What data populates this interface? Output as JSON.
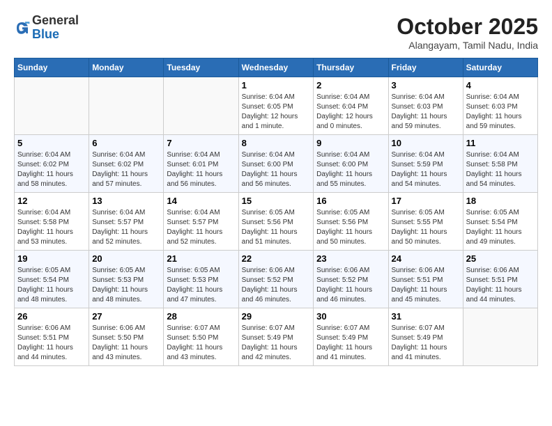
{
  "header": {
    "logo_line1": "General",
    "logo_line2": "Blue",
    "month": "October 2025",
    "location": "Alangayam, Tamil Nadu, India"
  },
  "weekdays": [
    "Sunday",
    "Monday",
    "Tuesday",
    "Wednesday",
    "Thursday",
    "Friday",
    "Saturday"
  ],
  "weeks": [
    [
      {
        "day": "",
        "info": ""
      },
      {
        "day": "",
        "info": ""
      },
      {
        "day": "",
        "info": ""
      },
      {
        "day": "1",
        "info": "Sunrise: 6:04 AM\nSunset: 6:05 PM\nDaylight: 12 hours\nand 1 minute."
      },
      {
        "day": "2",
        "info": "Sunrise: 6:04 AM\nSunset: 6:04 PM\nDaylight: 12 hours\nand 0 minutes."
      },
      {
        "day": "3",
        "info": "Sunrise: 6:04 AM\nSunset: 6:03 PM\nDaylight: 11 hours\nand 59 minutes."
      },
      {
        "day": "4",
        "info": "Sunrise: 6:04 AM\nSunset: 6:03 PM\nDaylight: 11 hours\nand 59 minutes."
      }
    ],
    [
      {
        "day": "5",
        "info": "Sunrise: 6:04 AM\nSunset: 6:02 PM\nDaylight: 11 hours\nand 58 minutes."
      },
      {
        "day": "6",
        "info": "Sunrise: 6:04 AM\nSunset: 6:02 PM\nDaylight: 11 hours\nand 57 minutes."
      },
      {
        "day": "7",
        "info": "Sunrise: 6:04 AM\nSunset: 6:01 PM\nDaylight: 11 hours\nand 56 minutes."
      },
      {
        "day": "8",
        "info": "Sunrise: 6:04 AM\nSunset: 6:00 PM\nDaylight: 11 hours\nand 56 minutes."
      },
      {
        "day": "9",
        "info": "Sunrise: 6:04 AM\nSunset: 6:00 PM\nDaylight: 11 hours\nand 55 minutes."
      },
      {
        "day": "10",
        "info": "Sunrise: 6:04 AM\nSunset: 5:59 PM\nDaylight: 11 hours\nand 54 minutes."
      },
      {
        "day": "11",
        "info": "Sunrise: 6:04 AM\nSunset: 5:58 PM\nDaylight: 11 hours\nand 54 minutes."
      }
    ],
    [
      {
        "day": "12",
        "info": "Sunrise: 6:04 AM\nSunset: 5:58 PM\nDaylight: 11 hours\nand 53 minutes."
      },
      {
        "day": "13",
        "info": "Sunrise: 6:04 AM\nSunset: 5:57 PM\nDaylight: 11 hours\nand 52 minutes."
      },
      {
        "day": "14",
        "info": "Sunrise: 6:04 AM\nSunset: 5:57 PM\nDaylight: 11 hours\nand 52 minutes."
      },
      {
        "day": "15",
        "info": "Sunrise: 6:05 AM\nSunset: 5:56 PM\nDaylight: 11 hours\nand 51 minutes."
      },
      {
        "day": "16",
        "info": "Sunrise: 6:05 AM\nSunset: 5:56 PM\nDaylight: 11 hours\nand 50 minutes."
      },
      {
        "day": "17",
        "info": "Sunrise: 6:05 AM\nSunset: 5:55 PM\nDaylight: 11 hours\nand 50 minutes."
      },
      {
        "day": "18",
        "info": "Sunrise: 6:05 AM\nSunset: 5:54 PM\nDaylight: 11 hours\nand 49 minutes."
      }
    ],
    [
      {
        "day": "19",
        "info": "Sunrise: 6:05 AM\nSunset: 5:54 PM\nDaylight: 11 hours\nand 48 minutes."
      },
      {
        "day": "20",
        "info": "Sunrise: 6:05 AM\nSunset: 5:53 PM\nDaylight: 11 hours\nand 48 minutes."
      },
      {
        "day": "21",
        "info": "Sunrise: 6:05 AM\nSunset: 5:53 PM\nDaylight: 11 hours\nand 47 minutes."
      },
      {
        "day": "22",
        "info": "Sunrise: 6:06 AM\nSunset: 5:52 PM\nDaylight: 11 hours\nand 46 minutes."
      },
      {
        "day": "23",
        "info": "Sunrise: 6:06 AM\nSunset: 5:52 PM\nDaylight: 11 hours\nand 46 minutes."
      },
      {
        "day": "24",
        "info": "Sunrise: 6:06 AM\nSunset: 5:51 PM\nDaylight: 11 hours\nand 45 minutes."
      },
      {
        "day": "25",
        "info": "Sunrise: 6:06 AM\nSunset: 5:51 PM\nDaylight: 11 hours\nand 44 minutes."
      }
    ],
    [
      {
        "day": "26",
        "info": "Sunrise: 6:06 AM\nSunset: 5:51 PM\nDaylight: 11 hours\nand 44 minutes."
      },
      {
        "day": "27",
        "info": "Sunrise: 6:06 AM\nSunset: 5:50 PM\nDaylight: 11 hours\nand 43 minutes."
      },
      {
        "day": "28",
        "info": "Sunrise: 6:07 AM\nSunset: 5:50 PM\nDaylight: 11 hours\nand 43 minutes."
      },
      {
        "day": "29",
        "info": "Sunrise: 6:07 AM\nSunset: 5:49 PM\nDaylight: 11 hours\nand 42 minutes."
      },
      {
        "day": "30",
        "info": "Sunrise: 6:07 AM\nSunset: 5:49 PM\nDaylight: 11 hours\nand 41 minutes."
      },
      {
        "day": "31",
        "info": "Sunrise: 6:07 AM\nSunset: 5:49 PM\nDaylight: 11 hours\nand 41 minutes."
      },
      {
        "day": "",
        "info": ""
      }
    ]
  ]
}
